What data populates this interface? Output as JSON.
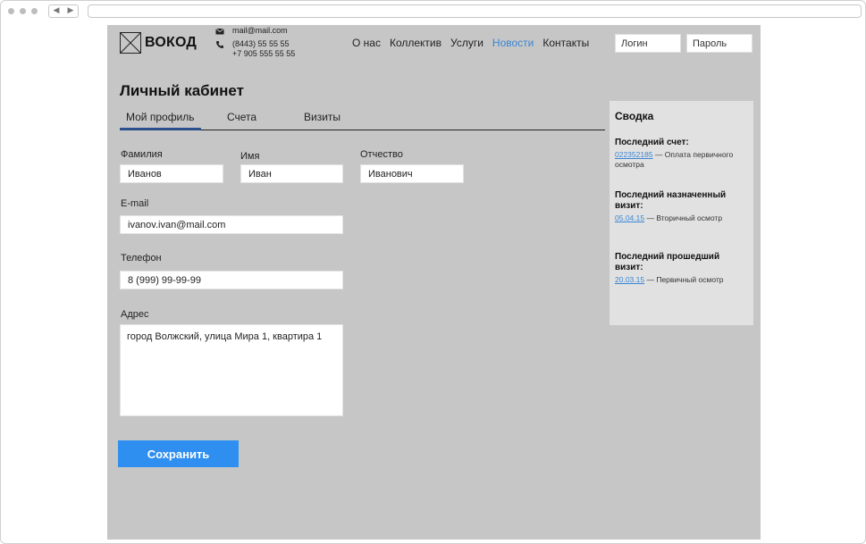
{
  "site": {
    "logo_text": "ВОКОД",
    "email": "mail@mail.com",
    "phone1": "(8443) 55 55 55",
    "phone2": "+7 905 555 55 55"
  },
  "nav": {
    "items": [
      "О нас",
      "Коллектив",
      "Услуги",
      "Новости",
      "Контакты"
    ],
    "active": "Новости",
    "active_color": "#3a86d4"
  },
  "auth": {
    "login_placeholder": "Логин",
    "password_placeholder": "Пароль"
  },
  "page": {
    "title": "Личный кабинет",
    "tabs": [
      "Мой профиль",
      "Счета",
      "Визиты"
    ],
    "active_tab": "Мой профиль"
  },
  "form": {
    "last_name_label": "Фамилия",
    "last_name_value": "Иванов",
    "first_name_label": "Имя",
    "first_name_value": "Иван",
    "patronymic_label": "Отчество",
    "patronymic_value": "Иванович",
    "email_label": "E-mail",
    "email_value": "ivanov.ivan@mail.com",
    "phone_label": "Телефон",
    "phone_value": "8 (999) 99-99-99",
    "address_label": "Адрес",
    "address_value": "город Волжский, улица Мира 1, квартира 1",
    "save_label": "Сохранить",
    "save_color": "#2f8ff0"
  },
  "summary": {
    "title": "Сводка",
    "last_invoice_heading": "Последний счет:",
    "last_invoice_link": "022352185",
    "last_invoice_text": "— Оплата первичного осмотра",
    "last_scheduled_heading": "Последний назначенный визит:",
    "last_scheduled_link": "05.04.15",
    "last_scheduled_text": "— Вторичный осмотр",
    "last_past_heading": "Последний прошедший визит:",
    "last_past_link": "20.03.15",
    "last_past_text": "— Первичный осмотр"
  }
}
